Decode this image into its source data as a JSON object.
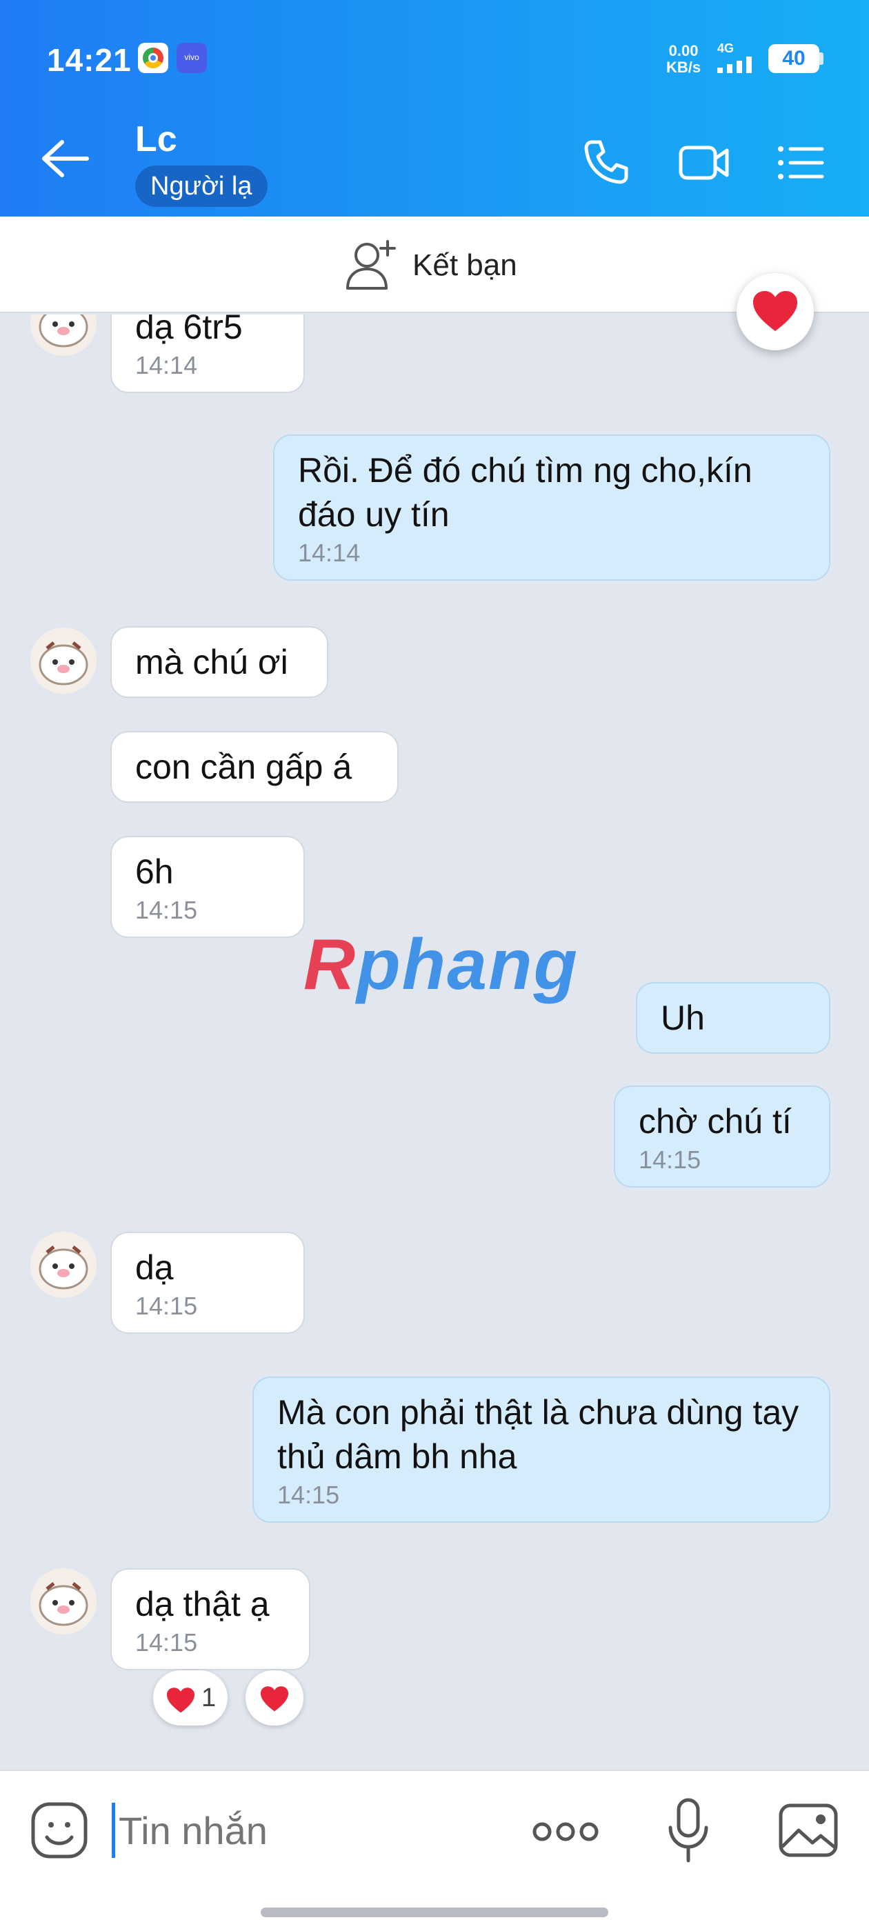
{
  "status_bar": {
    "time": "14:21",
    "net_speed_value": "0.00",
    "net_speed_unit": "KB/s",
    "network": "4G",
    "battery": "40"
  },
  "header": {
    "contact_name": "Lc",
    "badge": "Người lạ",
    "icons": [
      "back-arrow-icon",
      "phone-icon",
      "video-camera-icon",
      "list-menu-icon"
    ]
  },
  "friend_bar": {
    "label": "Kết bạn",
    "icon": "add-friend-icon"
  },
  "messages": [
    {
      "side": "in",
      "text": "dạ 6tr5",
      "time": "14:14"
    },
    {
      "side": "out",
      "text": "Rồi. Để đó chú tìm ng cho,kín đáo uy tín",
      "time": "14:14"
    },
    {
      "side": "in",
      "text": "mà chú ơi",
      "time": ""
    },
    {
      "side": "in",
      "text": "con cần gấp á",
      "time": ""
    },
    {
      "side": "in",
      "text": "6h",
      "time": "14:15"
    },
    {
      "side": "out",
      "text": "Uh",
      "time": ""
    },
    {
      "side": "out",
      "text": "chờ chú tí",
      "time": "14:15"
    },
    {
      "side": "in",
      "text": "dạ",
      "time": "14:15"
    },
    {
      "side": "out",
      "text": "Mà con phải thật là chưa dùng tay thủ dâm bh nha",
      "time": "14:15"
    },
    {
      "side": "in",
      "text": "dạ thật ạ",
      "time": "14:15"
    }
  ],
  "reaction": {
    "count": "1"
  },
  "watermark": {
    "first_letter": "R",
    "rest": "phang"
  },
  "input_bar": {
    "placeholder": "Tin nhắn"
  },
  "colors": {
    "header_blue": "#1f7cf5",
    "outgoing_bubble": "#d5ecfd",
    "chat_bg": "#e2e7ef",
    "heart_red": "#e8253a"
  }
}
